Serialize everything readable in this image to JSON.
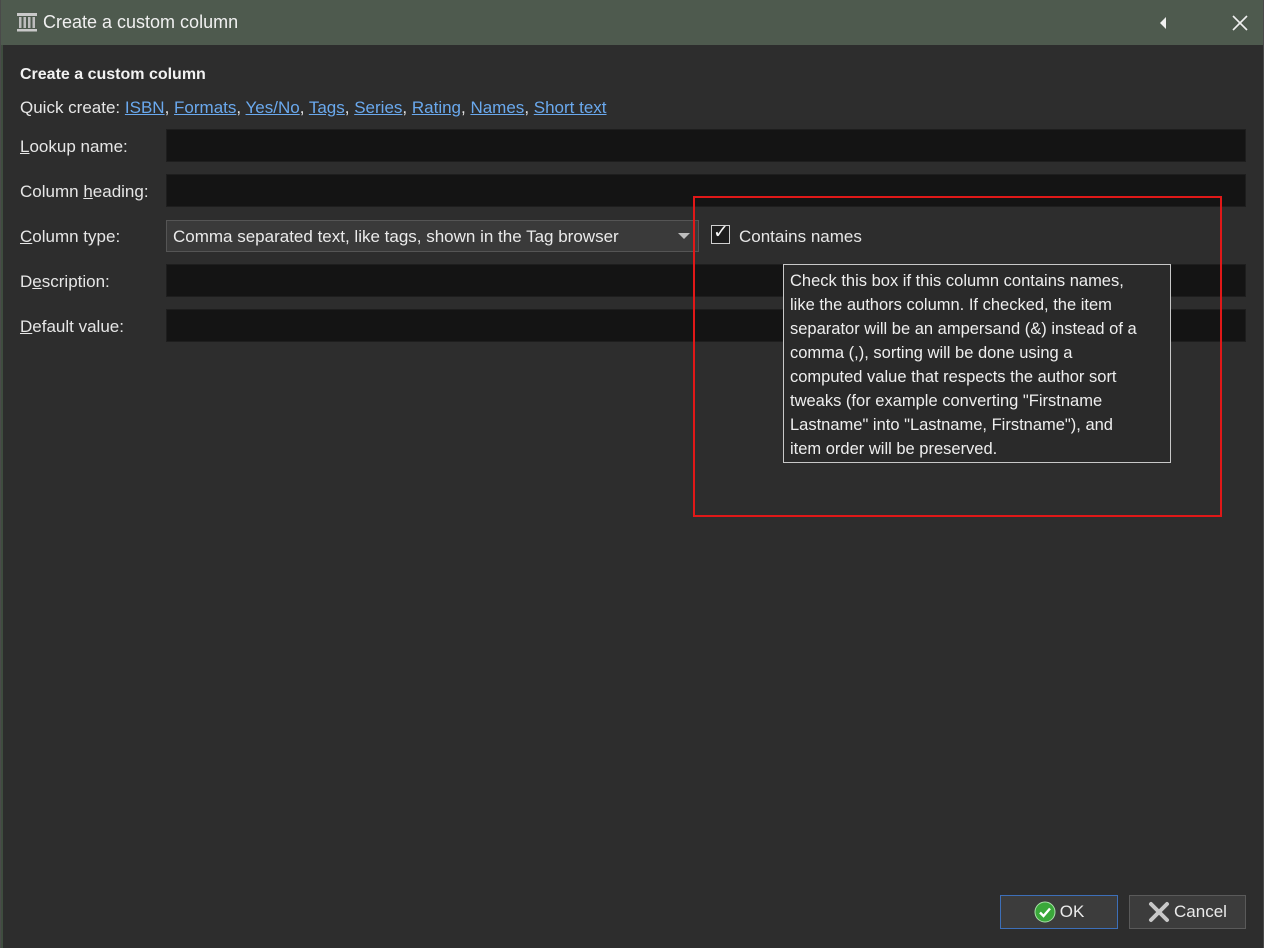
{
  "window": {
    "title": "Create a custom column"
  },
  "dialog": {
    "heading": "Create a custom column",
    "quick_create_label": "Quick create:",
    "quick_create_links": [
      "ISBN",
      "Formats",
      "Yes/No",
      "Tags",
      "Series",
      "Rating",
      "Names",
      "Short text"
    ],
    "fields": {
      "lookup_name": {
        "label_pre": "",
        "label_ul": "L",
        "label_post": "ookup name:",
        "value": ""
      },
      "column_heading": {
        "label_pre": "Column ",
        "label_ul": "h",
        "label_post": "eading:",
        "value": ""
      },
      "column_type": {
        "label_pre": "",
        "label_ul": "C",
        "label_post": "olumn type:",
        "value": "Comma separated text, like tags, shown in the Tag browser"
      },
      "description": {
        "label_pre": "D",
        "label_ul": "e",
        "label_post": "scription:",
        "value": ""
      },
      "default_value": {
        "label_pre": "",
        "label_ul": "D",
        "label_post": "efault value:",
        "value": ""
      }
    },
    "contains_names": {
      "label": "Contains names",
      "checked": true
    },
    "tooltip": {
      "lines": [
        "Check this box if this column contains names,",
        "like the authors column. If checked, the item",
        "separator will be an ampersand (&) instead of a",
        "comma (,), sorting will be done using a",
        "computed value that respects the author sort",
        "tweaks (for example converting \"Firstname",
        "Lastname\" into \"Lastname, Firstname\"), and",
        "item order will be preserved."
      ]
    },
    "buttons": {
      "ok": "OK",
      "cancel": "Cancel"
    }
  },
  "colors": {
    "titlebar": "#4e5a4e",
    "link": "#6aa9ee",
    "highlight": "#e01818"
  }
}
